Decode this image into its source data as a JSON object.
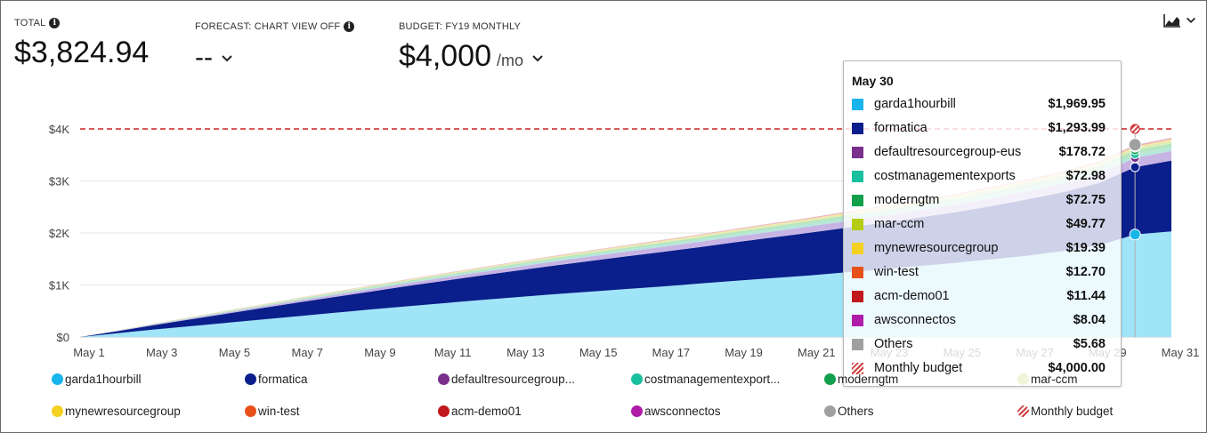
{
  "kpis": {
    "total": {
      "label": "TOTAL",
      "value": "$3,824.94"
    },
    "forecast": {
      "label": "FORECAST: CHART VIEW OFF",
      "value": "--"
    },
    "budget": {
      "label": "BUDGET: FY19 MONTHLY",
      "value": "$4,000",
      "unit": "/mo"
    }
  },
  "icons": {
    "info": "info-icon",
    "dropdown": "chevron-down-icon",
    "chart_type": "area-chart-icon"
  },
  "chart_data": {
    "type": "area",
    "stacked": true,
    "x": [
      1,
      2,
      3,
      4,
      5,
      6,
      7,
      8,
      9,
      10,
      11,
      12,
      13,
      14,
      15,
      16,
      17,
      18,
      19,
      20,
      21,
      22,
      23,
      24,
      25,
      26,
      27,
      28,
      29,
      30,
      31
    ],
    "x_tick_labels": [
      "May 1",
      "May 3",
      "May 5",
      "May 7",
      "May 9",
      "May 11",
      "May 13",
      "May 15",
      "May 17",
      "May 19",
      "May 21",
      "May 23",
      "May 25",
      "May 27",
      "May 29",
      "May 31"
    ],
    "x_tick_days": [
      1,
      3,
      5,
      7,
      9,
      11,
      13,
      15,
      17,
      19,
      21,
      23,
      25,
      27,
      29,
      31
    ],
    "y_ticks": [
      0,
      1000,
      2000,
      3000,
      4000
    ],
    "y_tick_labels": [
      "$0",
      "$1K",
      "$2K",
      "$3K",
      "$4K"
    ],
    "ylim": [
      0,
      4000
    ],
    "budget_line": 4000,
    "grid": true,
    "legend_position": "bottom",
    "series": [
      {
        "name": "garda1hourbill",
        "color": "#a0e4f8",
        "legend_color": "#18b4ec",
        "values": [
          0,
          70,
          140,
          205,
          270,
          335,
          400,
          465,
          530,
          590,
          650,
          710,
          765,
          820,
          870,
          920,
          970,
          1025,
          1080,
          1130,
          1180,
          1240,
          1300,
          1360,
          1420,
          1490,
          1560,
          1650,
          1760,
          1970,
          2030
        ]
      },
      {
        "name": "formatica",
        "color": "#0a1f8c",
        "legend_color": "#0a1f8c",
        "values": [
          0,
          40,
          85,
          130,
          175,
          220,
          265,
          305,
          345,
          390,
          430,
          470,
          510,
          550,
          590,
          630,
          665,
          700,
          740,
          780,
          820,
          855,
          890,
          930,
          970,
          1020,
          1080,
          1130,
          1200,
          1294,
          1360
        ]
      },
      {
        "name": "defaultresourcegroup-eus",
        "color": "#c8b4e4",
        "legend_color": "#7a2f8c",
        "values": [
          0,
          6,
          12,
          18,
          24,
          30,
          36,
          42,
          48,
          54,
          60,
          66,
          72,
          78,
          84,
          90,
          96,
          102,
          108,
          114,
          120,
          126,
          132,
          138,
          144,
          150,
          156,
          162,
          170,
          179,
          185
        ]
      },
      {
        "name": "costmanagementexports",
        "color": "#b6e6dc",
        "legend_color": "#18c0a0",
        "values": [
          0,
          2,
          5,
          7,
          10,
          12,
          15,
          17,
          20,
          22,
          25,
          27,
          30,
          32,
          35,
          37,
          40,
          42,
          45,
          47,
          50,
          53,
          56,
          59,
          62,
          65,
          68,
          70,
          72,
          73,
          74
        ]
      },
      {
        "name": "moderngtm",
        "color": "#b6e6c0",
        "legend_color": "#12a04c",
        "values": [
          0,
          2,
          5,
          7,
          10,
          12,
          15,
          17,
          20,
          22,
          25,
          27,
          30,
          32,
          35,
          37,
          40,
          42,
          45,
          47,
          50,
          53,
          56,
          59,
          62,
          65,
          68,
          70,
          72,
          73,
          74
        ]
      },
      {
        "name": "mar-ccm",
        "color": "#e0ecb4",
        "legend_color": "#f0f4d8",
        "values": [
          0,
          2,
          4,
          5,
          7,
          8,
          10,
          12,
          13,
          15,
          17,
          18,
          20,
          22,
          23,
          25,
          27,
          28,
          30,
          32,
          33,
          35,
          37,
          39,
          41,
          43,
          45,
          47,
          48,
          50,
          51
        ]
      },
      {
        "name": "mynewresourcegroup",
        "color": "#f8e8a0",
        "legend_color": "#f4d020",
        "values": [
          0,
          1,
          1,
          2,
          3,
          3,
          4,
          5,
          5,
          6,
          7,
          7,
          8,
          9,
          9,
          10,
          11,
          11,
          12,
          13,
          13,
          14,
          15,
          15,
          16,
          17,
          17,
          18,
          19,
          19,
          20
        ]
      },
      {
        "name": "win-test",
        "color": "#f4b8a4",
        "legend_color": "#e8501a",
        "values": [
          0,
          0,
          1,
          1,
          2,
          2,
          3,
          3,
          3,
          4,
          4,
          5,
          5,
          5,
          6,
          6,
          7,
          7,
          7,
          8,
          8,
          9,
          9,
          10,
          10,
          11,
          11,
          12,
          12,
          13,
          13
        ]
      },
      {
        "name": "acm-demo01",
        "color": "#e4a4a4",
        "legend_color": "#c0181c",
        "values": [
          0,
          0,
          1,
          1,
          1,
          2,
          2,
          3,
          3,
          3,
          4,
          4,
          4,
          5,
          5,
          5,
          6,
          6,
          6,
          7,
          7,
          8,
          8,
          8,
          9,
          9,
          10,
          10,
          11,
          11,
          12
        ]
      },
      {
        "name": "awsconnectos",
        "color": "#e8b0e0",
        "legend_color": "#b01ca8",
        "values": [
          0,
          0,
          1,
          1,
          1,
          1,
          2,
          2,
          2,
          2,
          3,
          3,
          3,
          3,
          4,
          4,
          4,
          4,
          5,
          5,
          5,
          5,
          6,
          6,
          6,
          7,
          7,
          7,
          8,
          8,
          8
        ]
      },
      {
        "name": "Others",
        "color": "#d8d8d8",
        "legend_color": "#a0a0a0",
        "values": [
          0,
          0,
          0,
          1,
          1,
          1,
          1,
          1,
          2,
          2,
          2,
          2,
          2,
          2,
          3,
          3,
          3,
          3,
          3,
          4,
          4,
          4,
          4,
          4,
          5,
          5,
          5,
          5,
          6,
          6,
          6
        ]
      }
    ],
    "budget_legend_name": "Monthly budget",
    "tooltip": {
      "title": "May 30",
      "day": 30,
      "rows": [
        {
          "name": "garda1hourbill",
          "value": "$1,969.95",
          "color": "#18b4ec"
        },
        {
          "name": "formatica",
          "value": "$1,293.99",
          "color": "#0a1f8c"
        },
        {
          "name": "defaultresourcegroup-eus",
          "value": "$178.72",
          "color": "#7a2f8c"
        },
        {
          "name": "costmanagementexports",
          "value": "$72.98",
          "color": "#18c0a0"
        },
        {
          "name": "moderngtm",
          "value": "$72.75",
          "color": "#12a04c"
        },
        {
          "name": "mar-ccm",
          "value": "$49.77",
          "color": "#b4cc14"
        },
        {
          "name": "mynewresourcegroup",
          "value": "$19.39",
          "color": "#f4d020"
        },
        {
          "name": "win-test",
          "value": "$12.70",
          "color": "#e8501a"
        },
        {
          "name": "acm-demo01",
          "value": "$11.44",
          "color": "#c0181c"
        },
        {
          "name": "awsconnectos",
          "value": "$8.04",
          "color": "#b01ca8"
        },
        {
          "name": "Others",
          "value": "$5.68",
          "color": "#a0a0a0"
        },
        {
          "name": "Monthly budget",
          "value": "$4,000.00",
          "color": "hatch"
        }
      ]
    }
  },
  "legend": [
    {
      "label": "garda1hourbill",
      "color": "#18b4ec"
    },
    {
      "label": "formatica",
      "color": "#0a1f8c"
    },
    {
      "label": "defaultresourcegroup...",
      "color": "#7a2f8c"
    },
    {
      "label": "costmanagementexport...",
      "color": "#18c0a0"
    },
    {
      "label": "moderngtm",
      "color": "#12a04c"
    },
    {
      "label": "mar-ccm",
      "color": "#f0f4d8"
    },
    {
      "label": "mynewresourcegroup",
      "color": "#f4d020"
    },
    {
      "label": "win-test",
      "color": "#e8501a"
    },
    {
      "label": "acm-demo01",
      "color": "#c0181c"
    },
    {
      "label": "awsconnectos",
      "color": "#b01ca8"
    },
    {
      "label": "Others",
      "color": "#a0a0a0"
    },
    {
      "label": "Monthly budget",
      "color": "hatch"
    }
  ]
}
